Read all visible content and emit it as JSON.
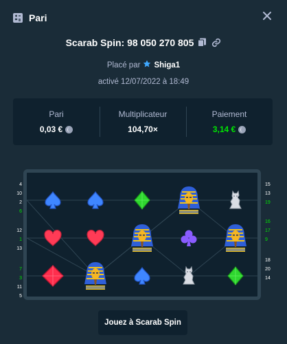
{
  "header": {
    "title": "Pari",
    "icon": "bet-slip-icon",
    "close_icon": "close-icon"
  },
  "bet": {
    "title": "Scarab Spin: 98 050 270 805",
    "copy_icon": "copy-icon",
    "link_icon": "link-icon",
    "placed_prefix": "Placé par",
    "user": "Shiga1",
    "user_icon": "star-badge-icon",
    "activated": "activé 12/07/2022 à 18:49"
  },
  "stats": [
    {
      "label": "Pari",
      "value": "0,03 €",
      "green": false
    },
    {
      "label": "Multiplicateur",
      "value": "104,70×",
      "green": false,
      "no_coin": true
    },
    {
      "label": "Paiement",
      "value": "3,14 €",
      "green": true
    }
  ],
  "grid": {
    "rows": [
      [
        "spade-blue",
        "spade-blue",
        "diamond-green",
        "pharaoh",
        "sphinx"
      ],
      [
        "heart-red",
        "heart-red",
        "pharaoh",
        "club-purple",
        "pharaoh"
      ],
      [
        "diamond-red",
        "pharaoh",
        "spade-blue",
        "sphinx",
        "diamond-green"
      ]
    ]
  },
  "paylines": {
    "left": [
      {
        "n": "4",
        "win": false
      },
      {
        "n": "10",
        "win": false
      },
      {
        "n": "2",
        "win": false
      },
      {
        "n": "6",
        "win": true
      },
      {
        "n": "12",
        "win": false
      },
      {
        "n": "1",
        "win": true
      },
      {
        "n": "13",
        "win": false
      },
      {
        "n": "7",
        "win": true
      },
      {
        "n": "3",
        "win": true
      },
      {
        "n": "11",
        "win": false
      },
      {
        "n": "5",
        "win": false
      }
    ],
    "right": [
      {
        "n": "15",
        "win": false
      },
      {
        "n": "13",
        "win": false
      },
      {
        "n": "19",
        "win": true
      },
      {
        "n": "16",
        "win": true
      },
      {
        "n": "17",
        "win": true
      },
      {
        "n": "9",
        "win": true
      },
      {
        "n": "18",
        "win": false
      },
      {
        "n": "20",
        "win": false
      },
      {
        "n": "14",
        "win": false
      }
    ]
  },
  "play_button": "Jouez à Scarab Spin",
  "colors": {
    "bg": "#1a2c38",
    "panel": "#0f212e",
    "win": "#00e701",
    "muted": "#b1bad3"
  }
}
